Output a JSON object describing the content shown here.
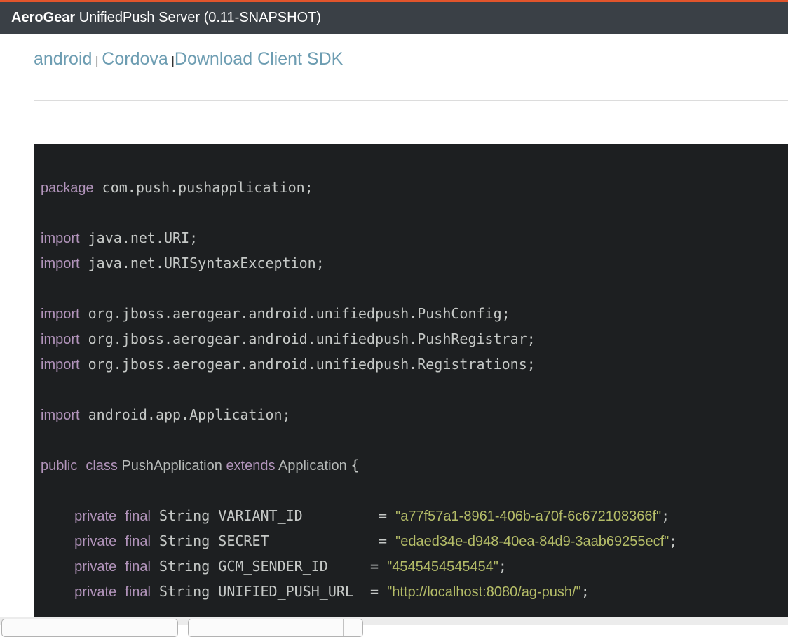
{
  "header": {
    "brand": "AeroGear",
    "title_rest": " UnifiedPush Server (0.11-SNAPSHOT)"
  },
  "nav": {
    "items": [
      {
        "type": "link",
        "text": "android"
      },
      {
        "type": "sep",
        "text": " | "
      },
      {
        "type": "link",
        "text": "Cordova"
      },
      {
        "type": "sep",
        "text": " |"
      },
      {
        "type": "link",
        "text": "Download Client SDK"
      }
    ]
  },
  "code": {
    "language": "java",
    "lines": [
      [
        [
          "k",
          "package"
        ],
        [
          "p",
          " com.push.pushapplication;"
        ]
      ],
      [],
      [
        [
          "k",
          "import"
        ],
        [
          "p",
          " java.net.URI;"
        ]
      ],
      [
        [
          "k",
          "import"
        ],
        [
          "p",
          " java.net.URISyntaxException;"
        ]
      ],
      [],
      [
        [
          "k",
          "import"
        ],
        [
          "p",
          " org.jboss.aerogear.android.unifiedpush.PushConfig;"
        ]
      ],
      [
        [
          "k",
          "import"
        ],
        [
          "p",
          " org.jboss.aerogear.android.unifiedpush.PushRegistrar;"
        ]
      ],
      [
        [
          "k",
          "import"
        ],
        [
          "p",
          " org.jboss.aerogear.android.unifiedpush.Registrations;"
        ]
      ],
      [],
      [
        [
          "k",
          "import"
        ],
        [
          "p",
          " android.app.Application;"
        ]
      ],
      [],
      [
        [
          "k",
          "public"
        ],
        [
          "p",
          " "
        ],
        [
          "k",
          "class"
        ],
        [
          "t",
          " PushApplication "
        ],
        [
          "k",
          "extends"
        ],
        [
          "t",
          " Application "
        ],
        [
          "p",
          "{"
        ]
      ],
      [],
      [
        [
          "p",
          "    "
        ],
        [
          "k",
          "private"
        ],
        [
          "p",
          " "
        ],
        [
          "k",
          "final"
        ],
        [
          "p",
          " String VARIANT_ID         = "
        ],
        [
          "s",
          "\"a77f57a1-8961-406b-a70f-6c672108366f\""
        ],
        [
          "p",
          ";"
        ]
      ],
      [
        [
          "p",
          "    "
        ],
        [
          "k",
          "private"
        ],
        [
          "p",
          " "
        ],
        [
          "k",
          "final"
        ],
        [
          "p",
          " String SECRET             = "
        ],
        [
          "s",
          "\"edaed34e-d948-40ea-84d9-3aab69255ecf\""
        ],
        [
          "p",
          ";"
        ]
      ],
      [
        [
          "p",
          "    "
        ],
        [
          "k",
          "private"
        ],
        [
          "p",
          " "
        ],
        [
          "k",
          "final"
        ],
        [
          "p",
          " String GCM_SENDER_ID     = "
        ],
        [
          "s",
          "\"4545454545454\""
        ],
        [
          "p",
          ";"
        ]
      ],
      [
        [
          "p",
          "    "
        ],
        [
          "k",
          "private"
        ],
        [
          "p",
          " "
        ],
        [
          "k",
          "final"
        ],
        [
          "p",
          " String UNIFIED_PUSH_URL  = "
        ],
        [
          "s",
          "\"http://localhost:8080/ag-push/\""
        ],
        [
          "p",
          ";"
        ]
      ]
    ]
  },
  "colors": {
    "header_bg": "#3a4046",
    "header_accent_top": "#e2552c",
    "nav_link": "#6d9db2",
    "code_bg": "#1d1f21",
    "code_plain": "#c5c8c6",
    "code_keyword": "#b294bb",
    "code_string": "#b5bd68"
  }
}
